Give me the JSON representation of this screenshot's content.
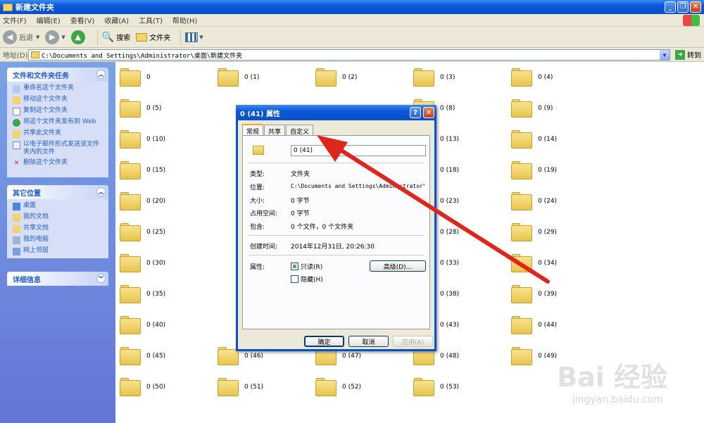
{
  "window": {
    "title": "新建文件夹"
  },
  "menu": [
    "文件(F)",
    "编辑(E)",
    "查看(V)",
    "收藏(A)",
    "工具(T)",
    "帮助(H)"
  ],
  "toolbar": {
    "back": "后退",
    "search": "搜索",
    "folders": "文件夹"
  },
  "address": {
    "label": "地址(D)",
    "value": "C:\\Documents and Settings\\Administrator\\桌面\\新建文件夹",
    "go": "转到"
  },
  "sidebar": {
    "tasks": {
      "title": "文件和文件夹任务",
      "items": [
        "重命名这个文件夹",
        "移动这个文件夹",
        "复制这个文件夹",
        "将这个文件夹发布到 Web",
        "共享此文件夹",
        "以电子邮件形式发送该文件夹内的文件",
        "删除这个文件夹"
      ]
    },
    "places": {
      "title": "其它位置",
      "items": [
        "桌面",
        "我的文档",
        "共享文档",
        "我的电脑",
        "网上邻居"
      ]
    },
    "details": {
      "title": "详细信息"
    }
  },
  "folders": [
    "0",
    "0 (1)",
    "0 (2)",
    "0 (3)",
    "0 (4)",
    "0 (5)",
    "",
    "",
    "0 (8)",
    "0 (9)",
    "0 (10)",
    "",
    "",
    "0 (13)",
    "0 (14)",
    "0 (15)",
    "",
    "",
    "0 (18)",
    "0 (19)",
    "0 (20)",
    "",
    "",
    "0 (23)",
    "0 (24)",
    "0 (25)",
    "",
    "",
    "0 (28)",
    "0 (29)",
    "0 (30)",
    "",
    "",
    "0 (33)",
    "0 (34)",
    "0 (35)",
    "",
    "",
    "0 (38)",
    "0 (39)",
    "0 (40)",
    "",
    "",
    "0 (43)",
    "0 (44)",
    "0 (45)",
    "0 (46)",
    "0 (47)",
    "0 (48)",
    "0 (49)",
    "0 (50)",
    "0 (51)",
    "0 (52)",
    "0 (53)",
    ""
  ],
  "dialog": {
    "title": "0 (41) 属性",
    "tabs": [
      "常规",
      "共享",
      "自定义"
    ],
    "name": "0 (41)",
    "type_label": "类型:",
    "type_value": "文件夹",
    "location_label": "位置:",
    "location_value": "C:\\Documents and Settings\\Administrator\\桌",
    "size_label": "大小:",
    "size_value": "0 字节",
    "disk_label": "占用空间:",
    "disk_value": "0 字节",
    "contains_label": "包含:",
    "contains_value": "0 个文件，0 个文件夹",
    "created_label": "创建时间:",
    "created_value": "2014年12月31日, 20:26:30",
    "attr_label": "属性:",
    "readonly": "只读(R)",
    "hidden": "隐藏(H)",
    "advanced": "高级(D)...",
    "ok": "确定",
    "cancel": "取消",
    "apply": "应用(A)"
  },
  "watermark": {
    "brand": "Bai 经验",
    "url": "jingyan.baidu.com"
  },
  "colors": {
    "xp_blue": "#0a50c8",
    "arrow": "#e0261c",
    "link": "#215dc6"
  }
}
